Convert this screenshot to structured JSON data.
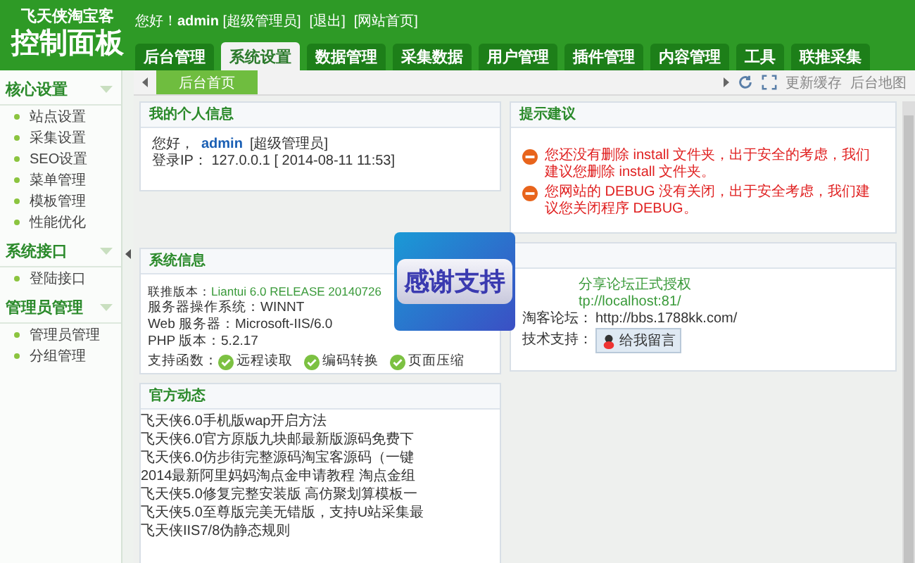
{
  "logo": {
    "top": "飞天侠淘宝客",
    "main": "控制面板"
  },
  "user_bar": {
    "greeting": "您好！",
    "user": "admin",
    "role": "[超级管理员]",
    "logout": "[退出]",
    "home": "[网站首页]"
  },
  "tabs": [
    {
      "label": "后台管理",
      "selected": false
    },
    {
      "label": "系统设置",
      "selected": true
    },
    {
      "label": "数据管理",
      "selected": false
    },
    {
      "label": "采集数据",
      "selected": false
    },
    {
      "label": "用户管理",
      "selected": false
    },
    {
      "label": "插件管理",
      "selected": false
    },
    {
      "label": "内容管理",
      "selected": false
    },
    {
      "label": "工具",
      "selected": false
    },
    {
      "label": "联推采集",
      "selected": false
    }
  ],
  "subnav": {
    "tab": "后台首页",
    "actions": [
      "更新缓存",
      "后台地图"
    ]
  },
  "sidebar": [
    {
      "title": "核心设置",
      "items": [
        "站点设置",
        "采集设置",
        "SEO设置",
        "菜单管理",
        "模板管理",
        "性能优化"
      ]
    },
    {
      "title": "系统接口",
      "items": [
        "登陆接口"
      ]
    },
    {
      "title": "管理员管理",
      "items": [
        "管理员管理",
        "分组管理"
      ]
    }
  ],
  "personal": {
    "title": "我的个人信息",
    "greeting": "您好，",
    "user": "admin",
    "role": "[超级管理员]",
    "login": "登录IP： 127.0.0.1 [ 2014-08-11 11:53]"
  },
  "tips": {
    "title": "提示建议",
    "items": [
      "您还没有删除 install 文件夹，出于安全的考虑，我们建议您删除 install 文件夹。",
      "您网站的 DEBUG 没有关闭，出于安全考虑，我们建议您关闭程序 DEBUG。"
    ]
  },
  "system": {
    "title": "系统信息",
    "rows": [
      {
        "label": "联推版本：",
        "value": "Liantui 6.0 RELEASE 20140726",
        "kind": "link"
      },
      {
        "label": "服务器操作系统：",
        "value": "WINNT",
        "kind": "text"
      },
      {
        "label": "Web 服务器：",
        "value": "Microsoft-IIS/6.0",
        "kind": "text"
      },
      {
        "label": "PHP 版本：",
        "value": "5.2.17",
        "kind": "text"
      }
    ],
    "support_label": "支持函数：",
    "support": [
      "远程读取",
      "编码转换",
      "页面压缩"
    ]
  },
  "about": {
    "rows": [
      {
        "value": "分享论坛正式授权",
        "kind": "link"
      },
      {
        "value": "tp://localhost:81/",
        "kind": "link"
      },
      {
        "label": "淘客论坛：",
        "value": "http://bbs.1788kk.com/",
        "kind": "text"
      },
      {
        "label": "技术支持：",
        "value": "给我留言",
        "kind": "button"
      }
    ]
  },
  "news": {
    "title": "官方动态",
    "items": [
      "飞天侠6.0手机版wap开启方法",
      "飞天侠6.0官方原版九块邮最新版源码免费下",
      "飞天侠6.0仿步街完整源码淘宝客源码（一键",
      "2014最新阿里妈妈淘点金申请教程 淘点金组",
      "飞天侠5.0修复完整安装版 高仿聚划算模板一",
      "飞天侠5.0至尊版完美无错版，支持U站采集最",
      "飞天侠IIS7/8伪静态规则"
    ]
  },
  "overlay": {
    "text": "感谢支持"
  }
}
